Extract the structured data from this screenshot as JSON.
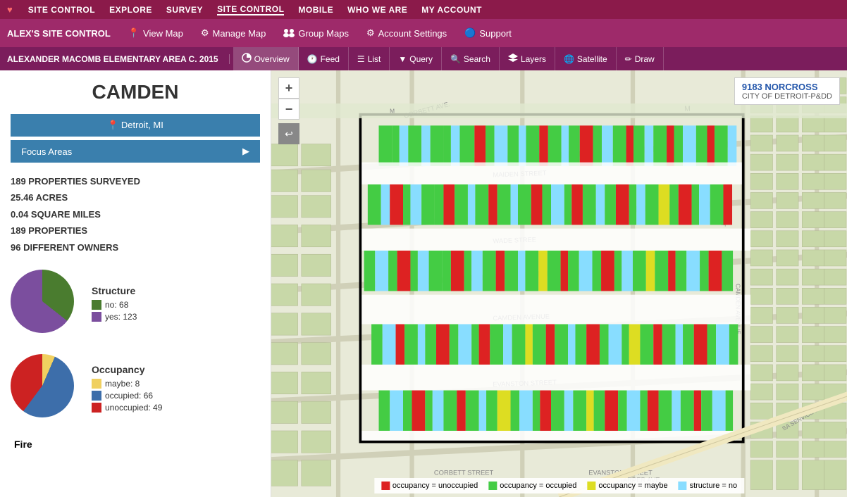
{
  "topNav": {
    "brand": "SITE CONTROL",
    "items": [
      {
        "label": "SITE CONTROL",
        "id": "site-control-link",
        "active": false
      },
      {
        "label": "EXPLORE",
        "id": "explore-link",
        "active": false
      },
      {
        "label": "SURVEY",
        "id": "survey-link",
        "active": false
      },
      {
        "label": "SITE CONTROL",
        "id": "site-control-main",
        "active": true
      },
      {
        "label": "MOBILE",
        "id": "mobile-link",
        "active": false
      },
      {
        "label": "WHO WE ARE",
        "id": "who-link",
        "active": false
      },
      {
        "label": "MY ACCOUNT",
        "id": "account-link",
        "active": false
      }
    ]
  },
  "secNav": {
    "siteTitle": "ALEX'S SITE CONTROL",
    "items": [
      {
        "label": "View Map",
        "icon": "📍"
      },
      {
        "label": "Manage Map",
        "icon": "⚙"
      },
      {
        "label": "Group Maps",
        "icon": "👥"
      },
      {
        "label": "Account Settings",
        "icon": "⚙"
      },
      {
        "label": "Support",
        "icon": "🔵"
      }
    ]
  },
  "thirdNav": {
    "areaTitle": "ALEXANDER MACOMB ELEMENTARY AREA C. 2015",
    "items": [
      {
        "label": "Overview",
        "icon": "pie",
        "active": true
      },
      {
        "label": "Feed",
        "icon": "clock",
        "active": false
      },
      {
        "label": "List",
        "icon": "list",
        "active": false
      },
      {
        "label": "Query",
        "icon": "filter",
        "active": false
      },
      {
        "label": "Search",
        "icon": "search",
        "active": false
      },
      {
        "label": "Layers",
        "icon": "layers",
        "active": false
      },
      {
        "label": "Satellite",
        "icon": "globe",
        "active": false
      },
      {
        "label": "Draw",
        "icon": "pencil",
        "active": false
      }
    ]
  },
  "panel": {
    "title": "CAMDEN",
    "locationBtn": "Detroit, MI",
    "focusBtn": "Focus Areas",
    "stats": [
      "189 PROPERTIES SURVEYED",
      "25.46 ACRES",
      "0.04 SQUARE MILES",
      "189 PROPERTIES",
      "96 DIFFERENT OWNERS"
    ],
    "structureChart": {
      "title": "Structure",
      "segments": [
        {
          "label": "no: 68",
          "color": "#4a7c2f",
          "value": 68
        },
        {
          "label": "yes: 123",
          "color": "#7B4E9E",
          "value": 123
        }
      ]
    },
    "occupancyChart": {
      "title": "Occupancy",
      "segments": [
        {
          "label": "maybe: 8",
          "color": "#f0d060",
          "value": 8
        },
        {
          "label": "occupied: 66",
          "color": "#3d6eaa",
          "value": 66
        },
        {
          "label": "unoccupied: 49",
          "color": "#cc2222",
          "value": 49
        }
      ]
    },
    "fireTitle": "Fire"
  },
  "mapInfo": {
    "address": "9183 NORCROSS",
    "city": "CITY OF DETROIT-P&DD"
  },
  "mapLegend": [
    {
      "label": "occupancy = unoccupied",
      "color": "#dd2222"
    },
    {
      "label": "occupancy = occupied",
      "color": "#44cc44"
    },
    {
      "label": "occupancy = maybe",
      "color": "#dddd22"
    },
    {
      "label": "structure = no",
      "color": "#88ddff"
    }
  ]
}
